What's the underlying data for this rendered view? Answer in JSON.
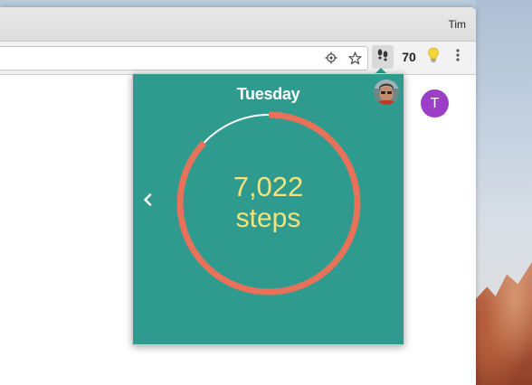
{
  "browser": {
    "profile_name": "Tim"
  },
  "toolbar": {
    "extension_step_count": "70",
    "location_icon": "target-location-icon",
    "bookmark_icon": "star-icon",
    "steps_extension_icon": "footprints-icon",
    "bulb_icon": "lightbulb-icon",
    "menu_icon": "vertical-dots-icon"
  },
  "page": {
    "avatar_letter": "T",
    "avatar_color": "#9b3fc7"
  },
  "popup": {
    "day": "Tuesday",
    "steps_value": "7,022",
    "steps_label": "steps",
    "goal_progress": 0.87,
    "background_color": "#2f9b8e",
    "ring_color": "#e8715a",
    "remaining_color": "#ffffff",
    "text_color": "#f5e27a"
  }
}
